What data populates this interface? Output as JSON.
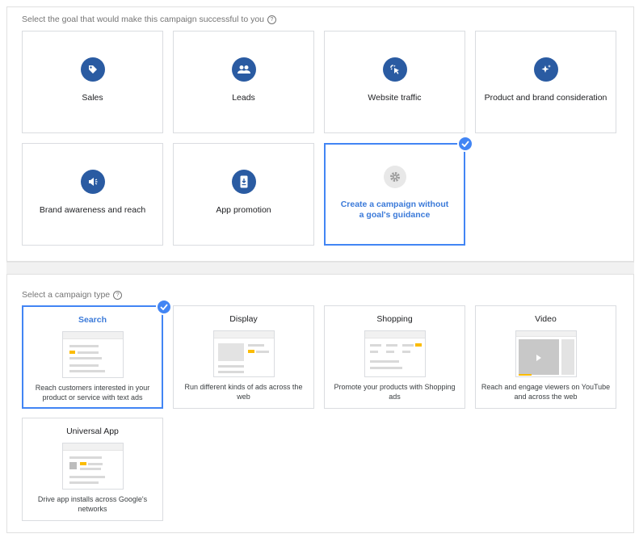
{
  "goal_section": {
    "prompt": "Select the goal that would make this campaign successful to you",
    "help_icon": "?",
    "goals": [
      {
        "label": "Sales",
        "icon": "tag-icon"
      },
      {
        "label": "Leads",
        "icon": "people-icon"
      },
      {
        "label": "Website traffic",
        "icon": "cursor-click-icon"
      },
      {
        "label": "Product and brand consideration",
        "icon": "sparkle-icon"
      },
      {
        "label": "Brand awareness and reach",
        "icon": "megaphone-icon"
      },
      {
        "label": "App promotion",
        "icon": "phone-download-icon"
      },
      {
        "label": "Create a campaign without a goal's guidance",
        "icon": "gear-icon",
        "selected": true
      }
    ]
  },
  "type_section": {
    "prompt": "Select a campaign type",
    "help_icon": "?",
    "types": [
      {
        "title": "Search",
        "desc": "Reach customers interested in your product or service with text ads",
        "selected": true
      },
      {
        "title": "Display",
        "desc": "Run different kinds of ads across the web"
      },
      {
        "title": "Shopping",
        "desc": "Promote your products with Shopping ads"
      },
      {
        "title": "Video",
        "desc": "Reach and engage viewers on YouTube and across the web"
      },
      {
        "title": "Universal App",
        "desc": "Drive app installs across Google's networks"
      }
    ]
  },
  "colors": {
    "accent": "#4285f4",
    "icon_bg": "#2a5ba2",
    "selected_text": "#3b7ad9",
    "ad_yellow": "#fbbc04"
  }
}
